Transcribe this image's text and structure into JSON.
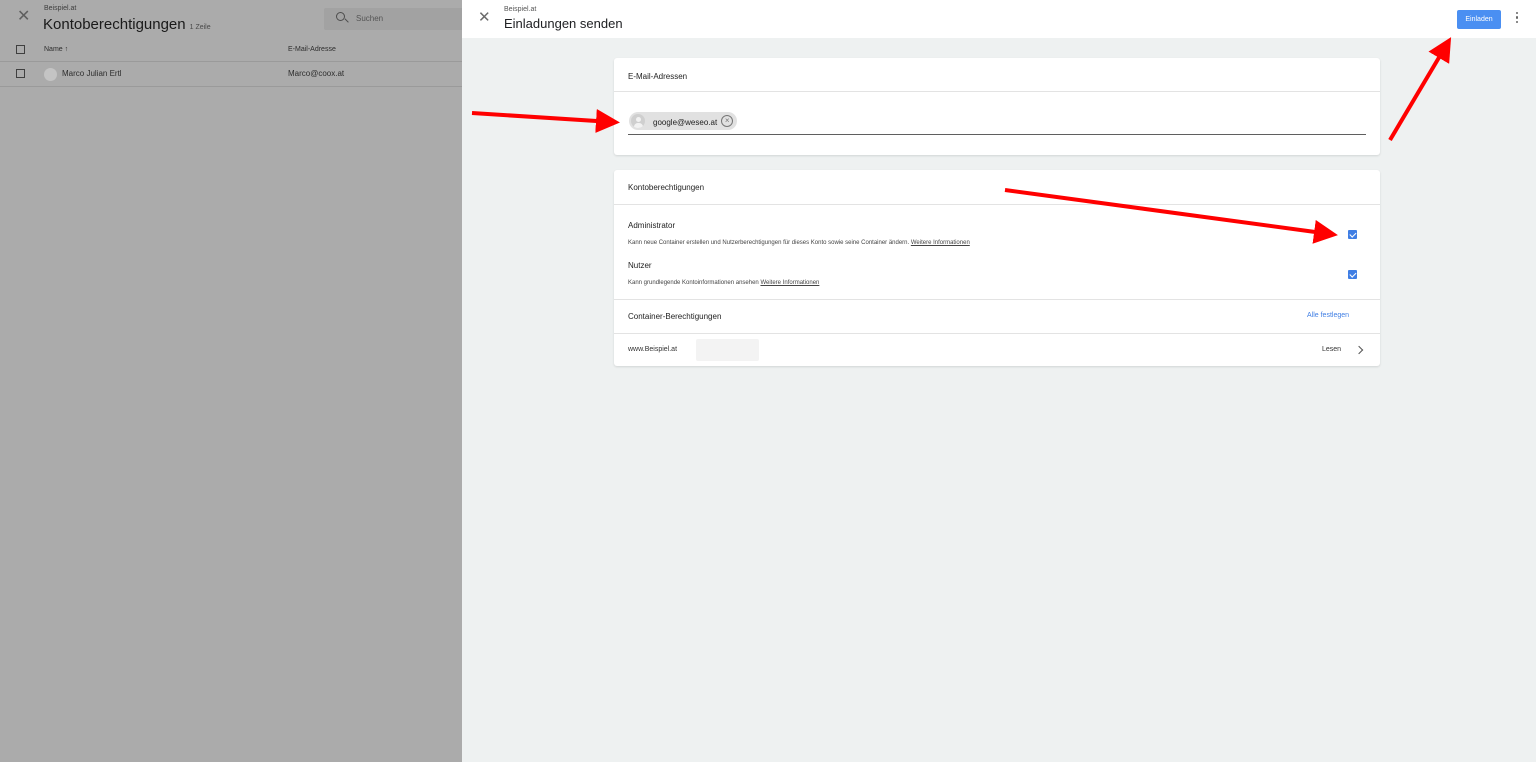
{
  "background": {
    "subtitle": "Beispiel.at",
    "title": "Kontoberechtigungen",
    "count": "1 Zeile",
    "search_placeholder": "Suchen",
    "columns": {
      "name": "Name ↑",
      "email": "E-Mail-Adresse"
    },
    "rows": [
      {
        "name": "Marco Julian Ertl",
        "email": "Marco@coox.at"
      }
    ]
  },
  "dialog": {
    "subtitle": "Beispiel.at",
    "title": "Einladungen senden",
    "invite_label": "Einladen",
    "email_section": {
      "title": "E-Mail-Adressen",
      "chips": [
        {
          "email": "google@weseo.at"
        }
      ]
    },
    "permissions_section": {
      "title": "Kontoberechtigungen",
      "admin": {
        "label": "Administrator",
        "description": "Kann neue Container erstellen und Nutzerberechtigungen für dieses Konto sowie seine Container ändern.",
        "link": "Weitere Informationen",
        "checked": true
      },
      "user": {
        "label": "Nutzer",
        "description": "Kann grundlegende Kontoinformationen ansehen",
        "link": "Weitere Informationen",
        "checked": true
      },
      "container_title": "Container-Berechtigungen",
      "set_all": "Alle festlegen",
      "containers": [
        {
          "name": "www.Beispiel.at",
          "permission": "Lesen"
        }
      ]
    }
  },
  "colors": {
    "primary": "#4a8ff2",
    "checkbox": "#3f7ee4",
    "arrow": "#ff0000"
  }
}
